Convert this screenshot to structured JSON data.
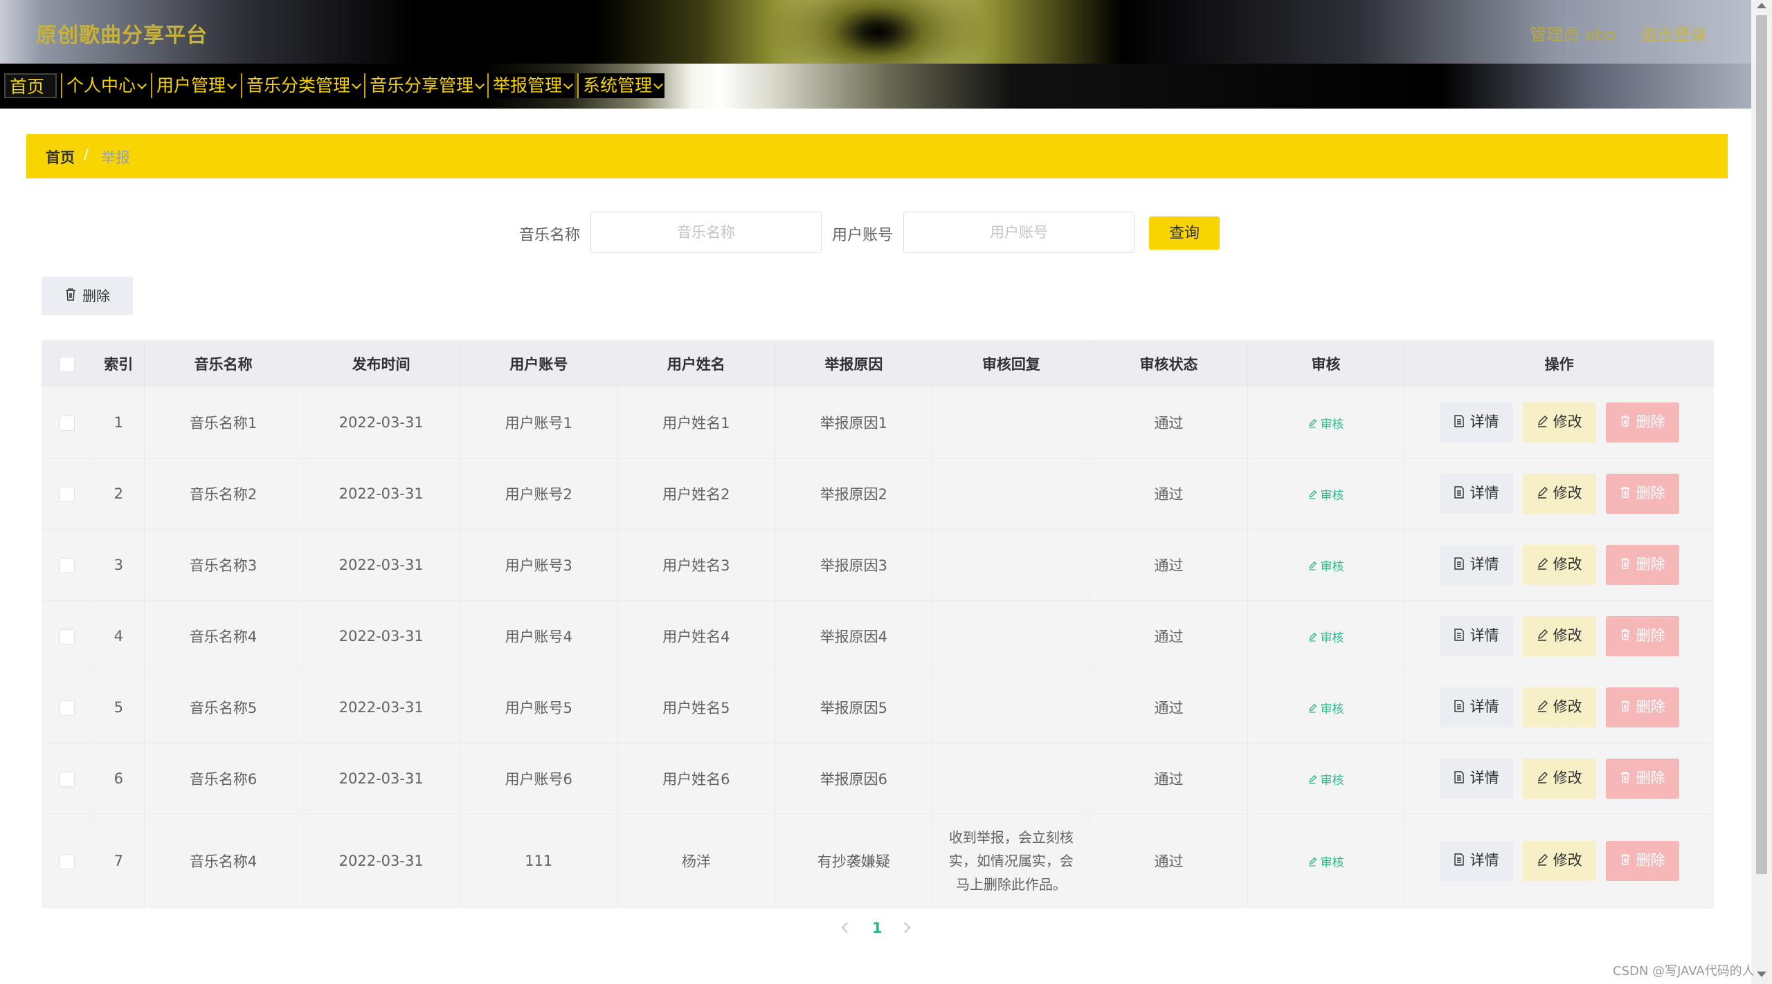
{
  "header": {
    "site_title": "原创歌曲分享平台",
    "user_label": "管理员 abo",
    "logout_label": "退出登录"
  },
  "nav": {
    "items": [
      {
        "label": "首页",
        "has_dropdown": false
      },
      {
        "label": "个人中心",
        "has_dropdown": true
      },
      {
        "label": "用户管理",
        "has_dropdown": true
      },
      {
        "label": "音乐分类管理",
        "has_dropdown": true
      },
      {
        "label": "音乐分享管理",
        "has_dropdown": true
      },
      {
        "label": "举报管理",
        "has_dropdown": true
      },
      {
        "label": "系统管理",
        "has_dropdown": true
      }
    ]
  },
  "breadcrumb": {
    "home": "首页",
    "separator": "/",
    "current": "举报"
  },
  "search": {
    "music_label": "音乐名称",
    "music_placeholder": "音乐名称",
    "music_value": "",
    "account_label": "用户账号",
    "account_placeholder": "用户账号",
    "account_value": "",
    "button_label": "查询"
  },
  "toolbar": {
    "batch_delete_label": "删除"
  },
  "table": {
    "columns": [
      "",
      "索引",
      "音乐名称",
      "发布时间",
      "用户账号",
      "用户姓名",
      "举报原因",
      "审核回复",
      "审核状态",
      "审核",
      "操作"
    ],
    "audit_link_label": "审核",
    "op_detail_label": "详情",
    "op_edit_label": "修改",
    "op_delete_label": "删除",
    "rows": [
      {
        "index": "1",
        "music": "音乐名称1",
        "date": "2022-03-31",
        "account": "用户账号1",
        "name": "用户姓名1",
        "reason": "举报原因1",
        "reply": "",
        "status": "通过"
      },
      {
        "index": "2",
        "music": "音乐名称2",
        "date": "2022-03-31",
        "account": "用户账号2",
        "name": "用户姓名2",
        "reason": "举报原因2",
        "reply": "",
        "status": "通过"
      },
      {
        "index": "3",
        "music": "音乐名称3",
        "date": "2022-03-31",
        "account": "用户账号3",
        "name": "用户姓名3",
        "reason": "举报原因3",
        "reply": "",
        "status": "通过"
      },
      {
        "index": "4",
        "music": "音乐名称4",
        "date": "2022-03-31",
        "account": "用户账号4",
        "name": "用户姓名4",
        "reason": "举报原因4",
        "reply": "",
        "status": "通过"
      },
      {
        "index": "5",
        "music": "音乐名称5",
        "date": "2022-03-31",
        "account": "用户账号5",
        "name": "用户姓名5",
        "reason": "举报原因5",
        "reply": "",
        "status": "通过"
      },
      {
        "index": "6",
        "music": "音乐名称6",
        "date": "2022-03-31",
        "account": "用户账号6",
        "name": "用户姓名6",
        "reason": "举报原因6",
        "reply": "",
        "status": "通过"
      },
      {
        "index": "7",
        "music": "音乐名称4",
        "date": "2022-03-31",
        "account": "111",
        "name": "杨洋",
        "reason": "有抄袭嫌疑",
        "reply": "收到举报，会立刻核实，如情况属实，会马上删除此作品。",
        "status": "通过"
      }
    ]
  },
  "pagination": {
    "current_page": "1"
  },
  "watermark": "CSDN @写JAVA代码的人",
  "colors": {
    "accent_yellow": "#f8d500",
    "audit_green": "#2fb78d",
    "delete_pink": "#f5b7b7",
    "edit_cream": "#f7efc5"
  }
}
